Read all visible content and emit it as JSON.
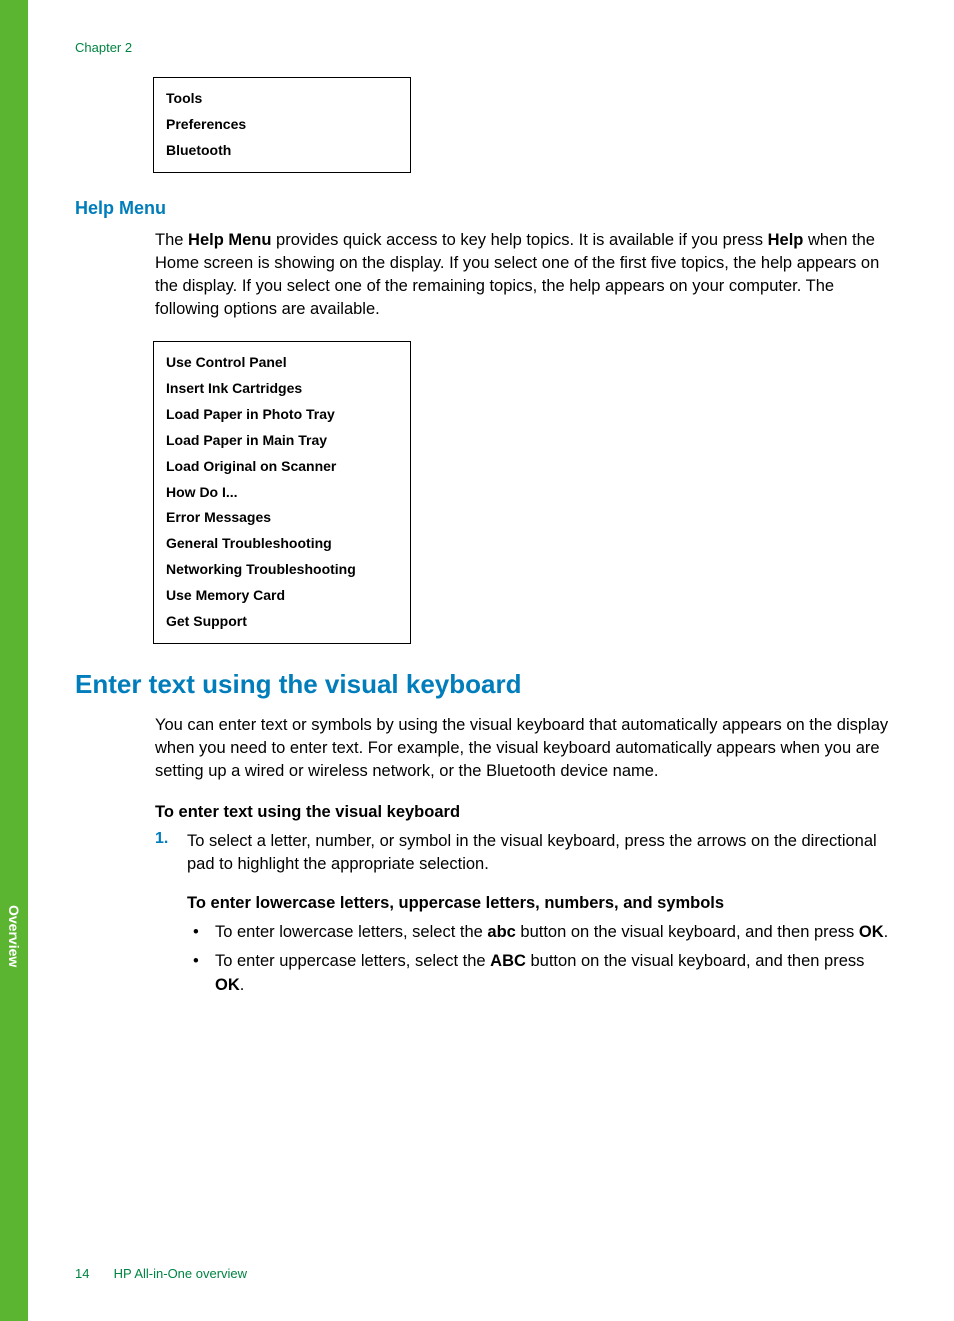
{
  "side_tab": "Overview",
  "chapter": "Chapter 2",
  "box1": {
    "items": [
      "Tools",
      "Preferences",
      "Bluetooth"
    ]
  },
  "help_menu": {
    "title": "Help Menu",
    "intro_part1": "The ",
    "intro_bold1": "Help Menu",
    "intro_part2": " provides quick access to key help topics. It is available if you press ",
    "intro_bold2": "Help",
    "intro_part3": " when the Home screen is showing on the display. If you select one of the first five topics, the help appears on the display. If you select one of the remaining topics, the help appears on your computer. The following options are available."
  },
  "box2": {
    "items": [
      "Use Control Panel",
      "Insert Ink Cartridges",
      "Load Paper in Photo Tray",
      "Load Paper in Main Tray",
      "Load Original on Scanner",
      "How Do I...",
      "Error Messages",
      "General Troubleshooting",
      "Networking Troubleshooting",
      "Use Memory Card",
      "Get Support"
    ]
  },
  "visual_kbd": {
    "title": "Enter text using the visual keyboard",
    "intro": "You can enter text or symbols by using the visual keyboard that automatically appears on the display when you need to enter text. For example, the visual keyboard automatically appears when you are setting up a wired or wireless network, or the Bluetooth device name.",
    "subhead": "To enter text using the visual keyboard",
    "step1_num": "1.",
    "step1_text": "To select a letter, number, or symbol in the visual keyboard, press the arrows on the directional pad to highlight the appropriate selection.",
    "inner_head": "To enter lowercase letters, uppercase letters, numbers, and symbols",
    "b1_part1": "To enter lowercase letters, select the ",
    "b1_bold1": "abc",
    "b1_part2": " button on the visual keyboard, and then press ",
    "b1_bold2": "OK",
    "b1_part3": ".",
    "b2_part1": "To enter uppercase letters, select the ",
    "b2_bold1": "ABC",
    "b2_part2": " button on the visual keyboard, and then press ",
    "b2_bold2": "OK",
    "b2_part3": "."
  },
  "footer": {
    "page": "14",
    "section": "HP All-in-One overview"
  }
}
